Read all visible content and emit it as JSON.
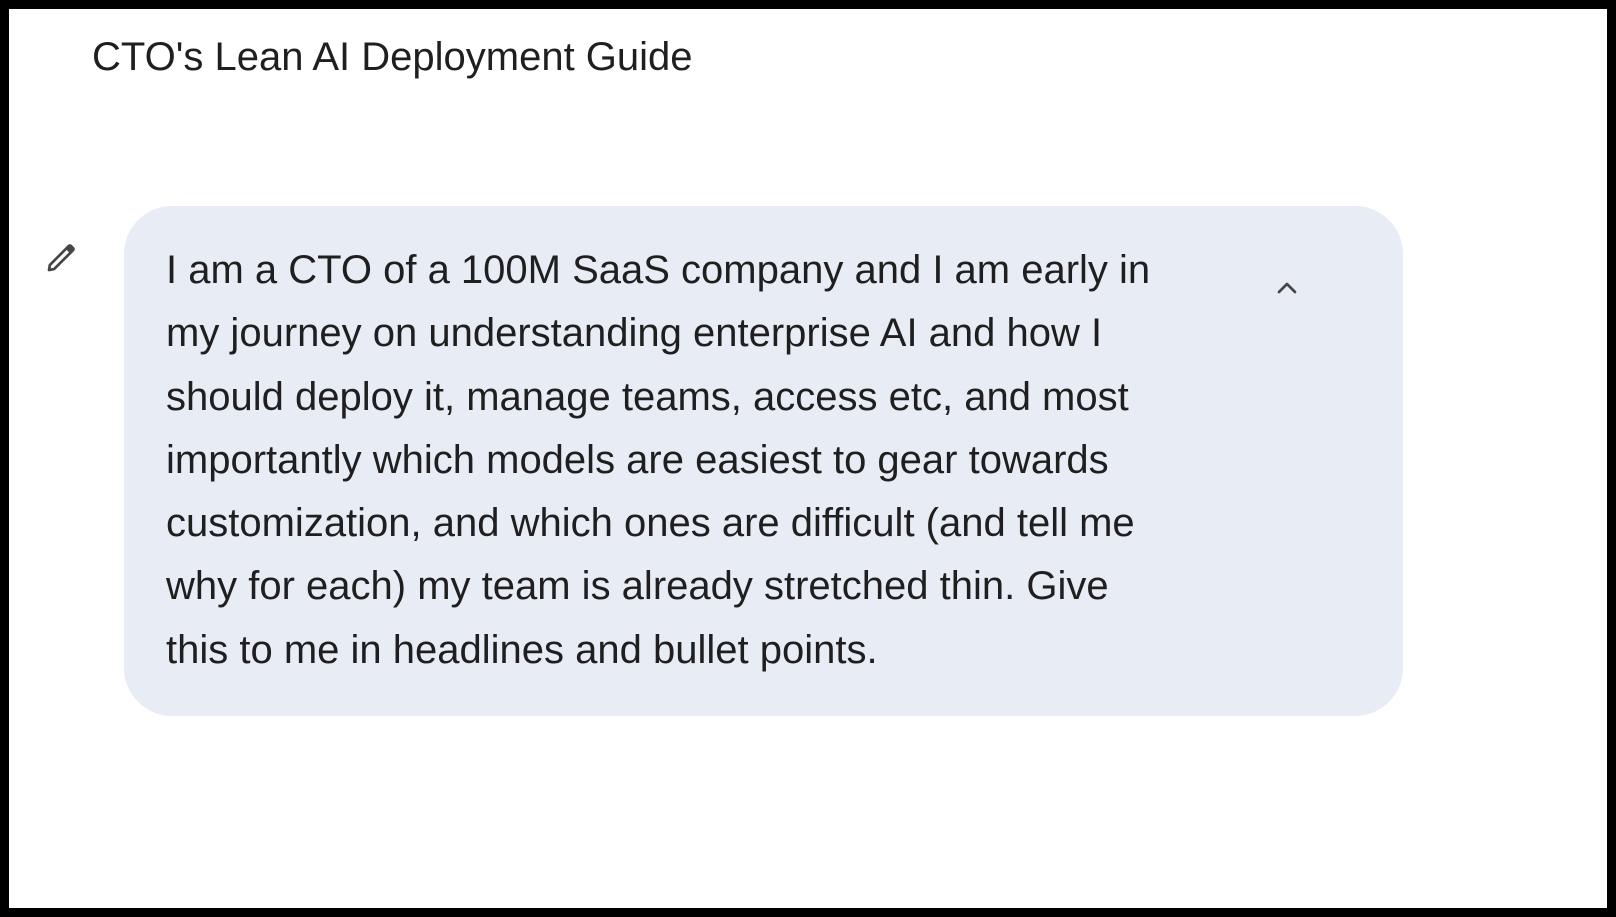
{
  "header": {
    "title": "CTO's Lean AI Deployment Guide"
  },
  "message": {
    "edit_icon": "pencil-icon",
    "collapse_icon": "chevron-up-icon",
    "lines": [
      "I am a CTO of a 100M SaaS company and I am early in",
      "my journey on understanding enterprise AI and how I",
      "should deploy it, manage teams, access etc, and most",
      "importantly which models are easiest to gear towards",
      "customization, and which ones are difficult (and tell me",
      "why for each) my team is already stretched thin. Give",
      "this to me in headlines and bullet points."
    ]
  },
  "colors": {
    "bubble_background": "#e8ecf5",
    "text": "#1f1f1f",
    "icon": "#444746",
    "page_background": "#ffffff",
    "frame_border": "#000000"
  }
}
